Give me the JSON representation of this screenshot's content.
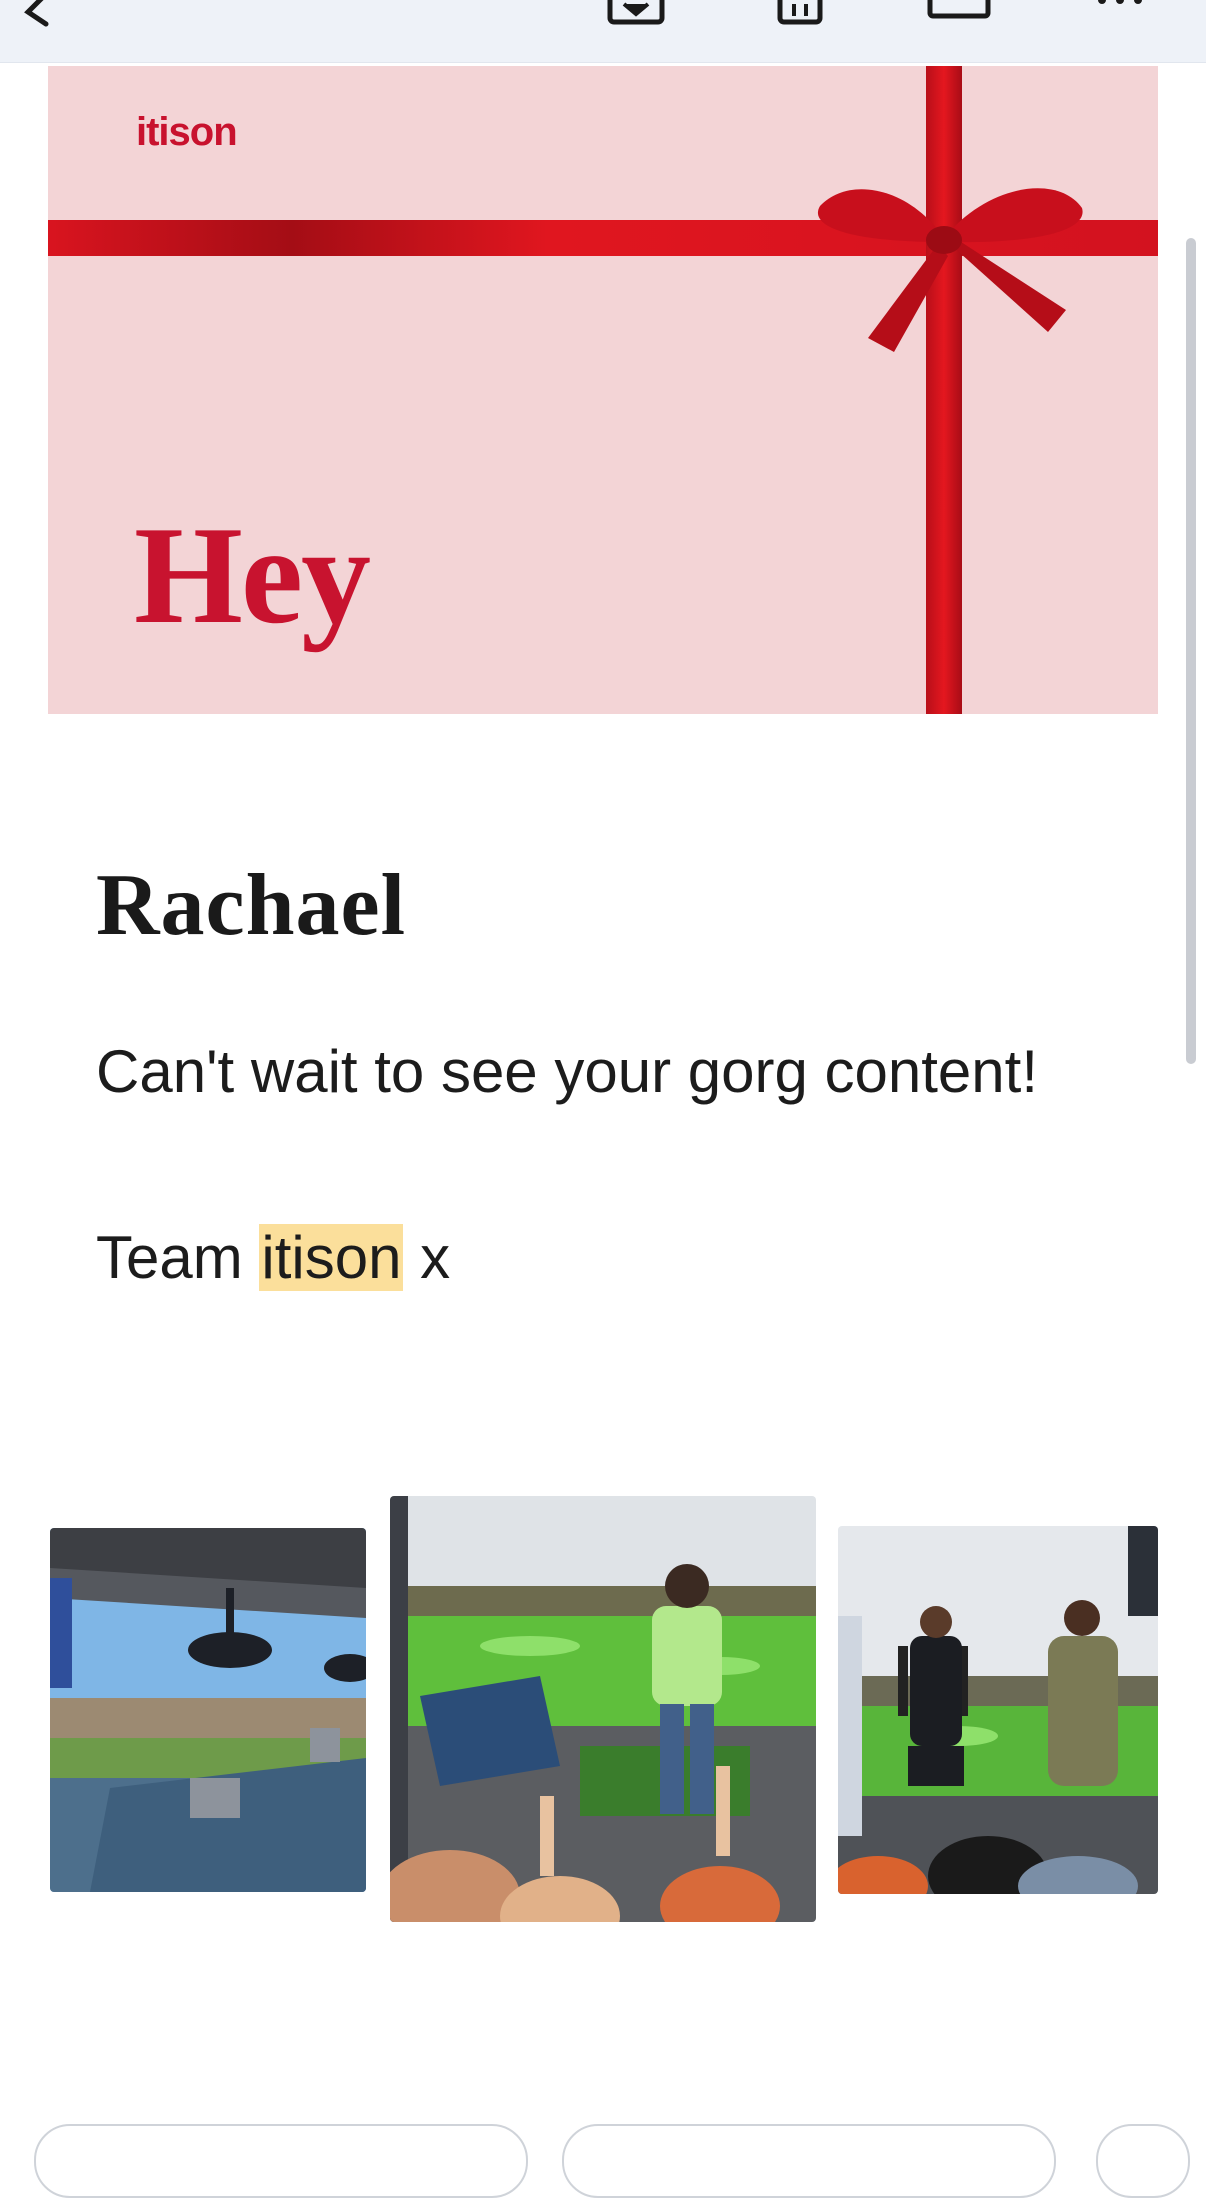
{
  "toolbar": {
    "icons": [
      "back-icon",
      "archive-icon",
      "delete-icon",
      "mail-icon",
      "more-icon"
    ]
  },
  "banner": {
    "brand": "itison",
    "greeting": "Hey",
    "colors": {
      "background": "#f3d4d6",
      "ribbon": "#d3121f",
      "text": "#c8132f"
    }
  },
  "email": {
    "recipient": "Rachael",
    "message": "Can't wait to see your gorg content!",
    "signoff_prefix": "Team",
    "signoff_highlight": "itison",
    "signoff_suffix": "x",
    "highlight_color": "#fbdf9b"
  },
  "gallery": {
    "photos": [
      "driving-range-bay-photo",
      "golfer-celebrating-photo",
      "group-cheering-photo"
    ]
  }
}
